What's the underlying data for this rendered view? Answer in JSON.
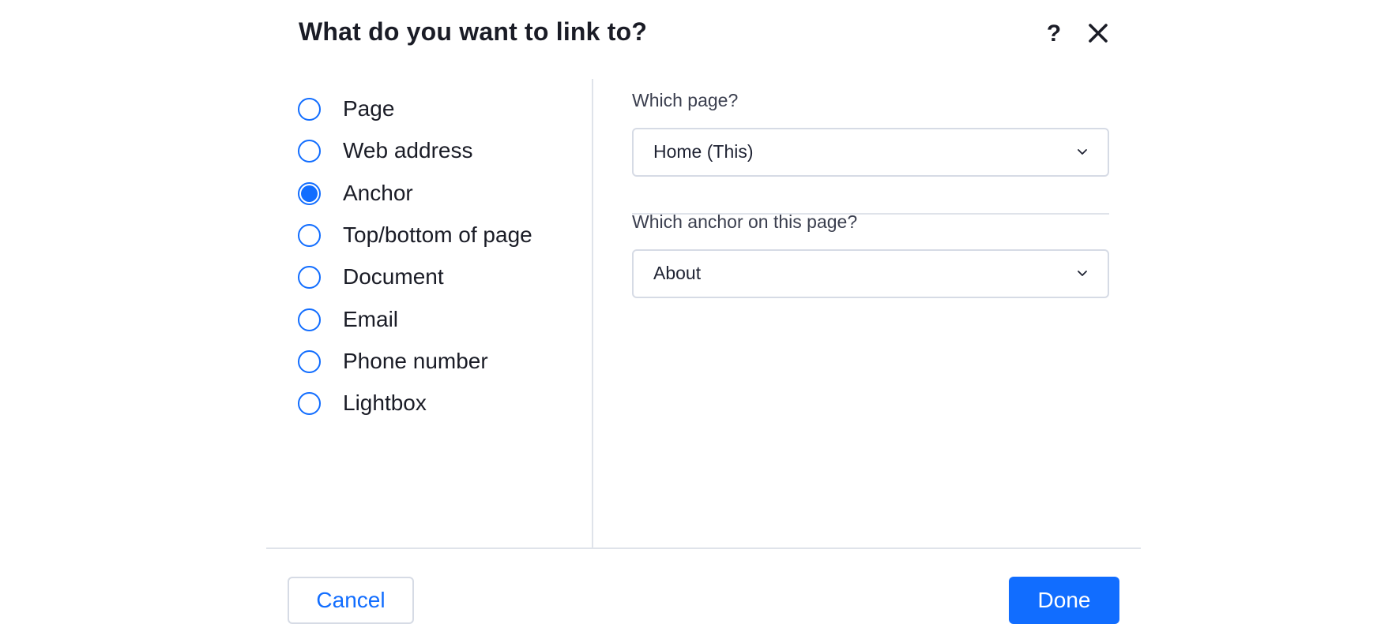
{
  "dialog": {
    "title": "What do you want to link to?",
    "help_label": "?",
    "close_icon": "close-icon"
  },
  "link_types": [
    {
      "label": "Page",
      "checked": false
    },
    {
      "label": "Web address",
      "checked": false
    },
    {
      "label": "Anchor",
      "checked": true
    },
    {
      "label": "Top/bottom of page",
      "checked": false
    },
    {
      "label": "Document",
      "checked": false
    },
    {
      "label": "Email",
      "checked": false
    },
    {
      "label": "Phone number",
      "checked": false
    },
    {
      "label": "Lightbox",
      "checked": false
    }
  ],
  "page_select": {
    "label": "Which page?",
    "value": "Home (This)"
  },
  "anchor_select": {
    "label": "Which anchor on this page?",
    "value": "About"
  },
  "footer": {
    "cancel_label": "Cancel",
    "done_label": "Done"
  },
  "colors": {
    "accent": "#116dff",
    "border": "#d6dbe5",
    "divider": "#dfe3ea",
    "text": "#1a1c26"
  }
}
